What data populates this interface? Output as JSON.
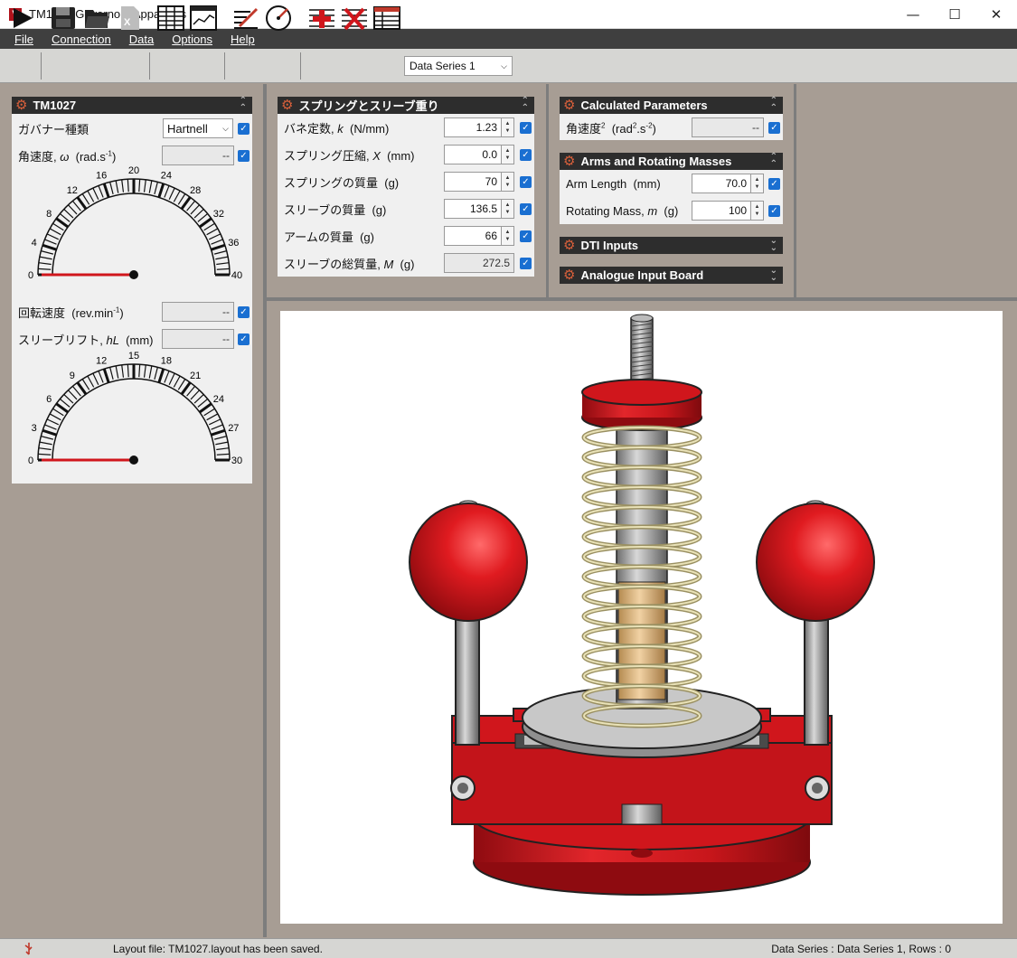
{
  "window": {
    "title": "TM1027 Governors Apparatus",
    "logo_letter": "V"
  },
  "menu": [
    {
      "label": "File"
    },
    {
      "label": "Connection"
    },
    {
      "label": "Data"
    },
    {
      "label": "Options"
    },
    {
      "label": "Help"
    }
  ],
  "toolbar": {
    "series_selected": "Data Series 1",
    "icons": [
      "play-icon",
      "save-icon",
      "open-folder-icon",
      "export-excel-icon",
      "table-view-icon",
      "graph-view-icon",
      "edit-calibrate-icon",
      "gauge-icon",
      "add-row-icon",
      "delete-row-icon",
      "table-icon"
    ]
  },
  "left_panel": {
    "title": "TM1027",
    "governor_type_label": "ガバナー種類",
    "governor_type_value": "Hartnell",
    "angular_velocity_label": "角速度,",
    "angular_velocity_symbol": "ω",
    "angular_velocity_unit": "(rad.s",
    "angular_velocity_unit_exp": "-1",
    "angular_velocity_value": "--",
    "gauge1_ticks": [
      "0",
      "4",
      "8",
      "12",
      "16",
      "20",
      "24",
      "28",
      "32",
      "36",
      "40"
    ],
    "gauge1_value": 0,
    "rotation_speed_label": "回転速度",
    "rotation_speed_unit": "(rev.min",
    "rotation_speed_unit_exp": "-1",
    "rotation_speed_value": "--",
    "sleeve_lift_label": "スリーブリフト,",
    "sleeve_lift_symbol": "hL",
    "sleeve_lift_unit": "(mm)",
    "sleeve_lift_value": "--",
    "gauge2_ticks": [
      "0",
      "3",
      "6",
      "9",
      "12",
      "15",
      "18",
      "21",
      "24",
      "27",
      "30"
    ],
    "gauge2_value": 0
  },
  "spring_panel": {
    "title": "スプリングとスリーブ重り",
    "rows": [
      {
        "label": "バネ定数,",
        "sym": "k",
        "unit": "(N/mm)",
        "value": "1.23"
      },
      {
        "label": "スプリング圧縮,",
        "sym": "X",
        "unit": "(mm)",
        "value": "0.0"
      },
      {
        "label": "スプリングの質量",
        "sym": "",
        "unit": "(g)",
        "value": "70"
      },
      {
        "label": "スリーブの質量",
        "sym": "",
        "unit": "(g)",
        "value": "136.5"
      },
      {
        "label": "アームの質量",
        "sym": "",
        "unit": "(g)",
        "value": "66"
      },
      {
        "label": "スリーブの総質量,",
        "sym": "M",
        "unit": "(g)",
        "value": "272.5"
      }
    ]
  },
  "calc_panel": {
    "title": "Calculated Parameters",
    "label": "角速度",
    "label_exp": "2",
    "unit": "(rad",
    "unit_exp1": "2",
    "unit_mid": ".s",
    "unit_exp2": "-2",
    "unit_end": ")",
    "value": "--"
  },
  "arms_panel": {
    "title": "Arms and Rotating Masses",
    "arm_length_label": "Arm Length",
    "arm_length_unit": "(mm)",
    "arm_length_value": "70.0",
    "mass_label": "Rotating Mass,",
    "mass_sym": "m",
    "mass_unit": "(g)",
    "mass_value": "100"
  },
  "dti_panel": {
    "title": "DTI Inputs"
  },
  "analogue_panel": {
    "title": "Analogue Input Board"
  },
  "status": {
    "message": "Layout file: TM1027.layout has been saved.",
    "right": "Data Series : Data Series 1,  Rows : 0"
  },
  "colors": {
    "accent_red": "#d0161c",
    "header_dark": "#2d2d2d",
    "check_blue": "#1a6fd1"
  }
}
